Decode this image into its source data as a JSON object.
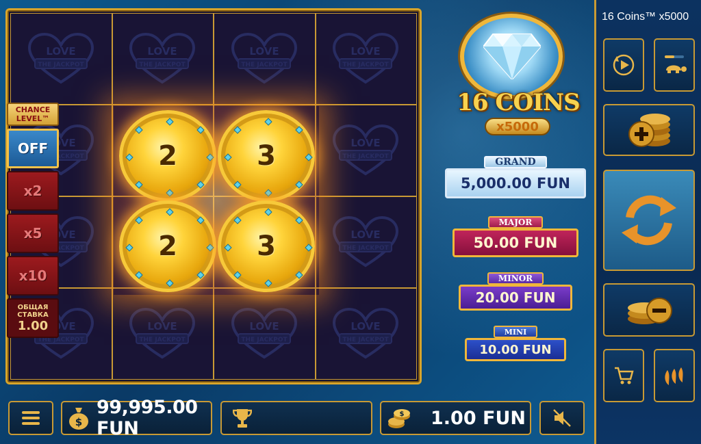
{
  "game": {
    "title": "16 Coins™ x5000"
  },
  "logo": {
    "title": "16 COINS",
    "subtitle": "x5000"
  },
  "reel_grid": {
    "ghost_symbol_line1": "LOVE",
    "ghost_symbol_line2": "THE JACKPOT",
    "coins": [
      {
        "value": "2"
      },
      {
        "value": "3"
      },
      {
        "value": "2"
      },
      {
        "value": "3"
      }
    ]
  },
  "chance_level": {
    "title": "CHANCE LEVEL™",
    "options": [
      "OFF",
      "x2",
      "x5",
      "x10"
    ],
    "selected": "OFF",
    "stake_label": "ОБЩАЯ СТАВКА",
    "stake_value": "1.00"
  },
  "jackpots": {
    "grand": {
      "label": "GRAND",
      "value": "5,000.00 FUN"
    },
    "major": {
      "label": "MAJOR",
      "value": "50.00 FUN"
    },
    "minor": {
      "label": "MINOR",
      "value": "20.00 FUN"
    },
    "mini": {
      "label": "MINI",
      "value": "10.00 FUN"
    }
  },
  "bottom_bar": {
    "balance": "99,995.00 FUN",
    "bet": "1.00 FUN"
  },
  "icons": {
    "menu": "hamburger-icon",
    "balance": "money-bag-icon",
    "trophy": "trophy-icon",
    "bet": "coins-icon",
    "mute": "speaker-muted-icon",
    "autoplay": "autoplay-icon",
    "turbo": "turtle-speed-icon",
    "bet_plus": "coins-plus-icon",
    "spin": "spin-arrows-icon",
    "bet_minus": "coins-minus-icon",
    "cart": "cart-icon",
    "volatility": "chili-icon"
  },
  "colors": {
    "gold": "#d8a42a",
    "grand": "#a9d2f0",
    "major": "#c0245a",
    "minor": "#7a3cc9",
    "mini": "#2d50c9"
  }
}
